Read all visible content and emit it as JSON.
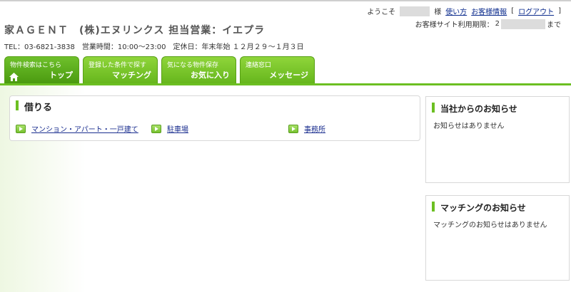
{
  "header": {
    "welcome": "ようこそ",
    "sama": "様",
    "links": {
      "usage": "使い方",
      "customer_info": "お客様情報",
      "logout": "ログアウト"
    },
    "bracket_open": "[",
    "bracket_close": "]",
    "expire_label": "お客様サイト利用期限：",
    "expire_prefix": "2",
    "expire_suffix": "まで",
    "company": "家ＡＧＥＮＴ　(株)エヌリンクス 担当営業：イエプラ",
    "tel": "TEL：03-6821-3838　営業時間：10:00～23:00　定休日：年末年始 １２月２９～１月３日"
  },
  "tabs": [
    {
      "sub": "物件検索はこちら",
      "main": "トップ"
    },
    {
      "sub": "登録した条件で探す",
      "main": "マッチング"
    },
    {
      "sub": "気になる物件保存",
      "main": "お気に入り"
    },
    {
      "sub": "連絡窓口",
      "main": "メッセージ"
    }
  ],
  "rent": {
    "title": "借りる",
    "links": [
      "マンション・アパート・一戸建て",
      "駐車場",
      "事務所"
    ]
  },
  "notices": {
    "company": {
      "title": "当社からのお知らせ",
      "text": "お知らせはありません"
    },
    "matching": {
      "title": "マッチングのお知らせ",
      "text": "マッチングのお知らせはありません"
    }
  },
  "colors": {
    "accent": "#6cbf22",
    "link": "#1a2e8f"
  }
}
